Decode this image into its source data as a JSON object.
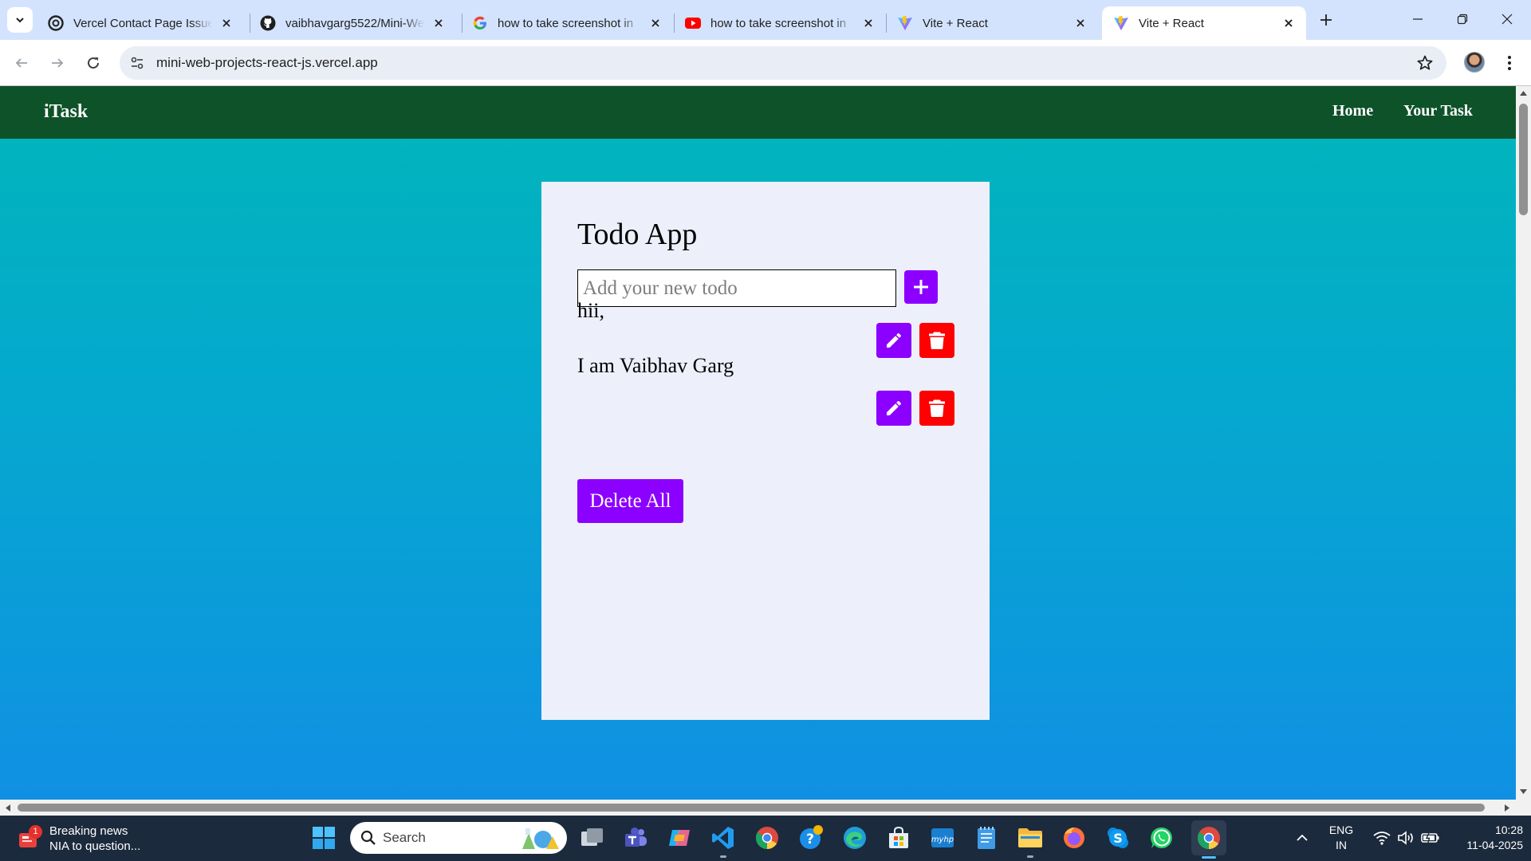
{
  "browser": {
    "tabs": [
      {
        "title": "Vercel Contact Page Issue",
        "icon": "openai-icon"
      },
      {
        "title": "vaibhavgarg5522/Mini-We",
        "icon": "github-icon"
      },
      {
        "title": "how to take screenshot in",
        "icon": "google-icon"
      },
      {
        "title": "how to take screenshot in",
        "icon": "youtube-icon"
      },
      {
        "title": "Vite + React",
        "icon": "vite-icon"
      },
      {
        "title": "Vite + React",
        "icon": "vite-icon",
        "active": true
      }
    ],
    "url": "mini-web-projects-react-js.vercel.app"
  },
  "site": {
    "brand": "iTask",
    "nav": {
      "home": "Home",
      "your_task": "Your Task"
    },
    "colors": {
      "nav_bg": "#0e5229",
      "accent": "#8b00ff",
      "danger": "#ff0000",
      "card_bg": "#edf0fb"
    }
  },
  "todo": {
    "title": "Todo App",
    "input_placeholder": "Add your new todo",
    "input_value": "",
    "items": [
      {
        "text": "hii,"
      },
      {
        "text": "I am Vaibhav Garg"
      }
    ],
    "delete_all_label": "Delete All"
  },
  "taskbar": {
    "news_title": "Breaking news",
    "news_subtitle": "NIA to question...",
    "news_badge": "1",
    "search_label": "Search",
    "lang_top": "ENG",
    "lang_bottom": "IN",
    "time": "10:28",
    "date": "11-04-2025"
  }
}
